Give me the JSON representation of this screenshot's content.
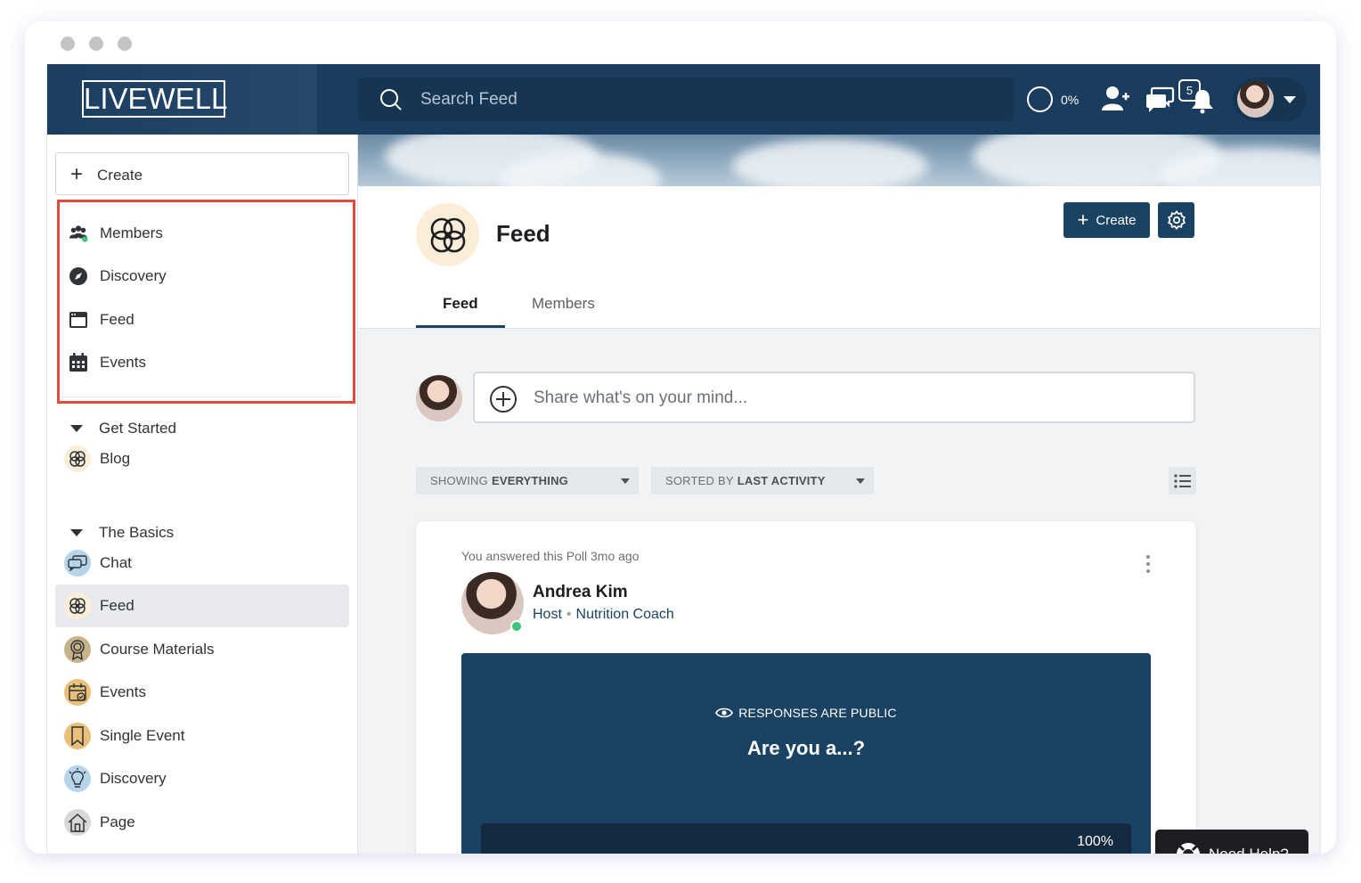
{
  "brand": {
    "logo_text": "LIVEWELL"
  },
  "topbar": {
    "search_placeholder": "Search Feed",
    "progress_label": "0%",
    "notification_count": "5"
  },
  "sidebar": {
    "create_label": "Create",
    "nav_items": [
      {
        "label": "Members",
        "icon": "members-icon"
      },
      {
        "label": "Discovery",
        "icon": "compass-icon"
      },
      {
        "label": "Feed",
        "icon": "feed-window-icon"
      },
      {
        "label": "Events",
        "icon": "calendar-icon"
      }
    ],
    "sections": [
      {
        "title": "Get Started",
        "items": [
          {
            "label": "Blog",
            "icon": "flower-icon"
          }
        ]
      },
      {
        "title": "The Basics",
        "items": [
          {
            "label": "Chat",
            "icon": "chat-icon"
          },
          {
            "label": "Feed",
            "icon": "flower-icon",
            "active": true
          },
          {
            "label": "Course Materials",
            "icon": "award-icon"
          },
          {
            "label": "Events",
            "icon": "calendar-check-icon"
          },
          {
            "label": "Single Event",
            "icon": "bookmark-icon"
          },
          {
            "label": "Discovery",
            "icon": "lightbulb-icon"
          },
          {
            "label": "Page",
            "icon": "house-icon"
          }
        ]
      }
    ]
  },
  "header": {
    "title": "Feed",
    "create_button": "Create",
    "tabs": [
      {
        "label": "Feed",
        "active": true
      },
      {
        "label": "Members",
        "active": false
      }
    ]
  },
  "composer": {
    "placeholder": "Share what's on your mind..."
  },
  "filters": {
    "showing_prefix": "SHOWING",
    "showing_value": "EVERYTHING",
    "sorted_prefix": "SORTED BY",
    "sorted_value": "LAST ACTIVITY"
  },
  "post": {
    "meta": "You answered this Poll 3mo ago",
    "author": "Andrea Kim",
    "role": "Host",
    "title": "Nutrition Coach",
    "poll": {
      "visibility": "RESPONSES ARE PUBLIC",
      "question": "Are you a...?",
      "option_percent": "100%"
    }
  },
  "help": {
    "label": "Need Help?"
  },
  "colors": {
    "primary": "#1a4262",
    "topbar": "#1a3c5e",
    "highlight": "#e64a3b",
    "online": "#3cc47c"
  }
}
